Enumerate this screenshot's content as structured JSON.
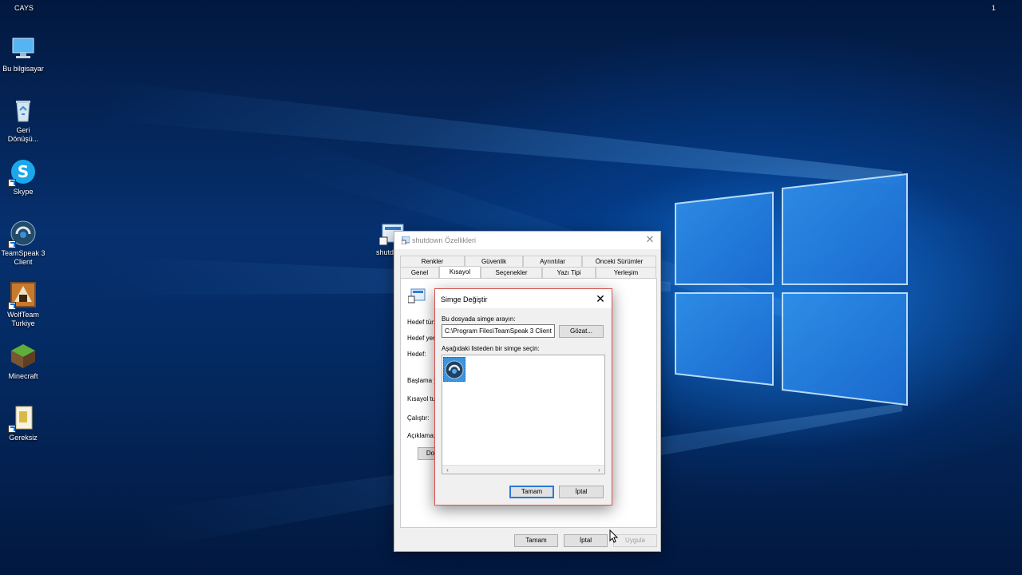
{
  "desktop": {
    "top_left_label": "CAYS",
    "top_right_label": "1",
    "icons": [
      {
        "label": "Bu bilgisayar",
        "icon": "computer-icon"
      },
      {
        "label": "Geri Dönüşü...",
        "icon": "recycle-bin-icon"
      },
      {
        "label": "Skype",
        "icon": "skype-icon"
      },
      {
        "label": "TeamSpeak 3 Client",
        "icon": "teamspeak-icon"
      },
      {
        "label": "WolfTeam Turkiye",
        "icon": "wolfteam-icon"
      },
      {
        "label": "Minecraft",
        "icon": "minecraft-icon"
      },
      {
        "label": "Gereksiz",
        "icon": "shortcut-file-icon"
      }
    ],
    "behind_icon_label": "shutd"
  },
  "properties_window": {
    "title": "shutdown Özellikleri",
    "tabs_row1": [
      "Renkler",
      "Güvenlik",
      "Ayrıntılar",
      "Önceki Sürümler"
    ],
    "tabs_row2": [
      "Genel",
      "Kısayol",
      "Seçenekler",
      "Yazı Tipi",
      "Yerleşim"
    ],
    "active_tab": "Kısayol",
    "fields": [
      "Hedef tür:",
      "Hedef yer:",
      "Hedef:",
      "Başlama y",
      "Kısayol tu",
      "Çalıştır:",
      "Açıklama:"
    ],
    "open_location_button": "Dosy",
    "buttons": {
      "ok": "Tamam",
      "cancel": "İptal",
      "apply": "Uygula"
    }
  },
  "change_icon_dialog": {
    "title": "Simge Değiştir",
    "search_label": "Bu dosyada simge arayın:",
    "path_value": "C:\\Program Files\\TeamSpeak 3 Client",
    "browse_button": "Gözat...",
    "list_label": "Aşağıdaki listeden bir simge seçin:",
    "selected_icon": "teamspeak-icon",
    "buttons": {
      "ok": "Tamam",
      "cancel": "İptal"
    }
  },
  "colors": {
    "dialog_border": "#d9534f",
    "selection": "#3a94e0",
    "primary_button_border": "#2a78d6"
  }
}
